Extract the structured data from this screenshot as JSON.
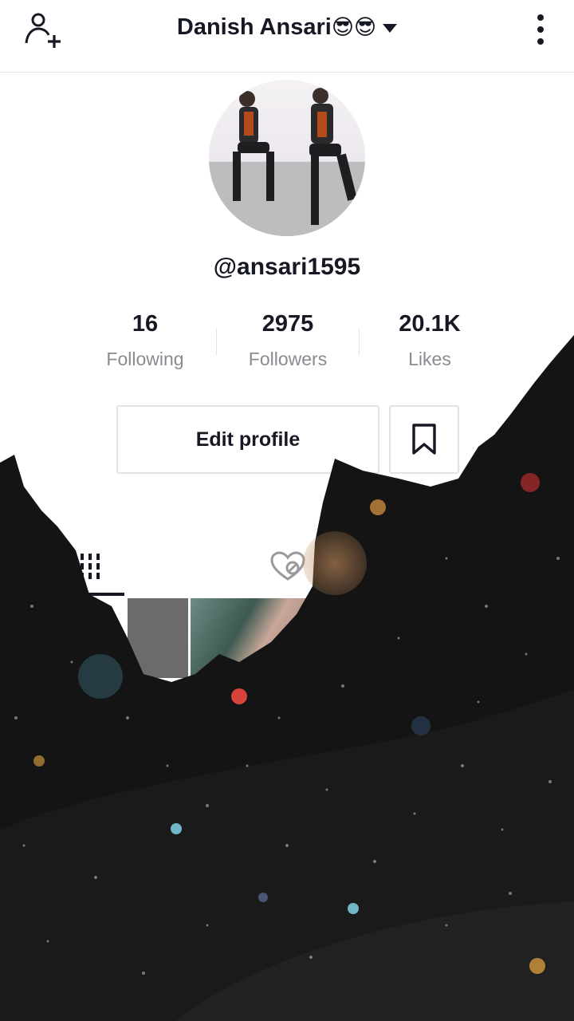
{
  "header": {
    "title": "Danish Ansari",
    "title_emojis": "😎😎",
    "icons": {
      "left": "add-friend-icon",
      "title_caret": "chevron-down-icon",
      "right": "more-vertical-icon"
    }
  },
  "profile": {
    "username": "@ansari1595",
    "avatar": "two-people-sitting-photo"
  },
  "stats": [
    {
      "value": "16",
      "label": "Following"
    },
    {
      "value": "2975",
      "label": "Followers"
    },
    {
      "value": "20.1K",
      "label": "Likes"
    }
  ],
  "actions": {
    "edit_profile_label": "Edit profile",
    "bookmark_icon": "bookmark-icon"
  },
  "tabs": [
    {
      "icon": "grid-icon",
      "selected": true
    },
    {
      "icon": "liked-heart-icon",
      "selected": false
    }
  ],
  "colors": {
    "text_primary": "#161823",
    "text_secondary": "#8a8b91",
    "border": "#e3e3e4",
    "overlay_dark": "#111111"
  }
}
